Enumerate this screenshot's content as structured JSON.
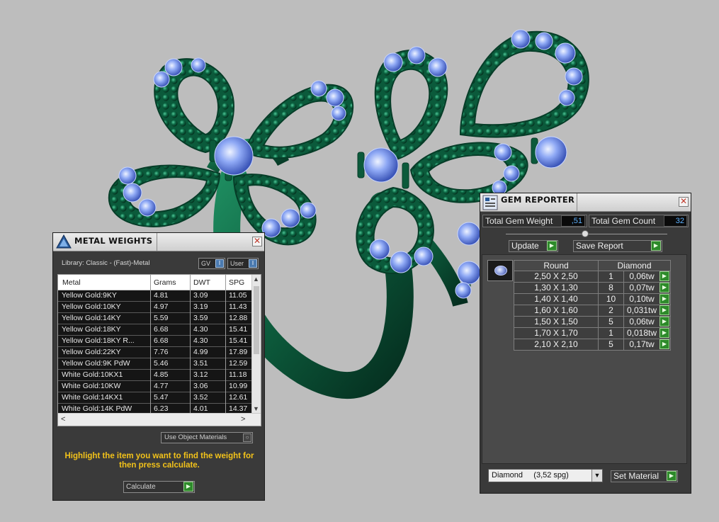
{
  "metal_weights": {
    "title": "METAL WEIGHTS",
    "library": "Library: Classic - (Fast)-Metal",
    "gv_label": "GV",
    "user_label": "User",
    "toggle_glyph": "I",
    "columns": [
      "Metal",
      "Grams",
      "DWT",
      "SPG"
    ],
    "rows": [
      {
        "metal": "Yellow Gold:9KY",
        "grams": "4.81",
        "dwt": "3.09",
        "spg": "11.05"
      },
      {
        "metal": "Yellow Gold:10KY",
        "grams": "4.97",
        "dwt": "3.19",
        "spg": "11.43"
      },
      {
        "metal": "Yellow Gold:14KY",
        "grams": "5.59",
        "dwt": "3.59",
        "spg": "12.88"
      },
      {
        "metal": "Yellow Gold:18KY",
        "grams": "6.68",
        "dwt": "4.30",
        "spg": "15.41"
      },
      {
        "metal": "Yellow Gold:18KY R...",
        "grams": "6.68",
        "dwt": "4.30",
        "spg": "15.41"
      },
      {
        "metal": "Yellow Gold:22KY",
        "grams": "7.76",
        "dwt": "4.99",
        "spg": "17.89"
      },
      {
        "metal": "Yellow Gold:9K PdW",
        "grams": "5.46",
        "dwt": "3.51",
        "spg": "12.59"
      },
      {
        "metal": "White Gold:10KX1",
        "grams": "4.85",
        "dwt": "3.12",
        "spg": "11.18"
      },
      {
        "metal": "White Gold:10KW",
        "grams": "4.77",
        "dwt": "3.06",
        "spg": "10.99"
      },
      {
        "metal": "White Gold:14KX1",
        "grams": "5.47",
        "dwt": "3.52",
        "spg": "12.61"
      },
      {
        "metal": "White Gold:14K PdW",
        "grams": "6.23",
        "dwt": "4.01",
        "spg": "14.37"
      }
    ],
    "use_object_materials": "Use Object Materials",
    "hint": "Highlight the item you want to find the weight for then press calculate.",
    "calculate_label": "Calculate"
  },
  "gem_reporter": {
    "title": "GEM REPORTER",
    "total_weight_label": "Total Gem Weight",
    "total_weight_value": ",51",
    "total_count_label": "Total Gem Count",
    "total_count_value": "32",
    "update_label": "Update",
    "save_report_label": "Save Report",
    "columns": [
      "Round",
      "Diamond"
    ],
    "rows": [
      {
        "size": "2,50 X 2,50",
        "count": "1",
        "weight": "0,06tw"
      },
      {
        "size": "1,30 X 1,30",
        "count": "8",
        "weight": "0,07tw"
      },
      {
        "size": "1,40 X 1,40",
        "count": "10",
        "weight": "0,10tw"
      },
      {
        "size": "1,60 X 1,60",
        "count": "2",
        "weight": "0,031tw"
      },
      {
        "size": "1,50 X 1,50",
        "count": "5",
        "weight": "0,06tw"
      },
      {
        "size": "1,70 X 1,70",
        "count": "1",
        "weight": "0,018tw"
      },
      {
        "size": "2,10 X 2,10",
        "count": "5",
        "weight": "0,17tw"
      }
    ],
    "material": "Diamond     (3,52 spg)",
    "set_material_label": "Set Material"
  },
  "colors": {
    "ring_metal": "#0f6e4a",
    "gem_blue": "#7f9ff0",
    "hint_yellow": "#f2c21a",
    "value_blue": "#5fb2ff",
    "button_green": "#2d8a2a"
  }
}
